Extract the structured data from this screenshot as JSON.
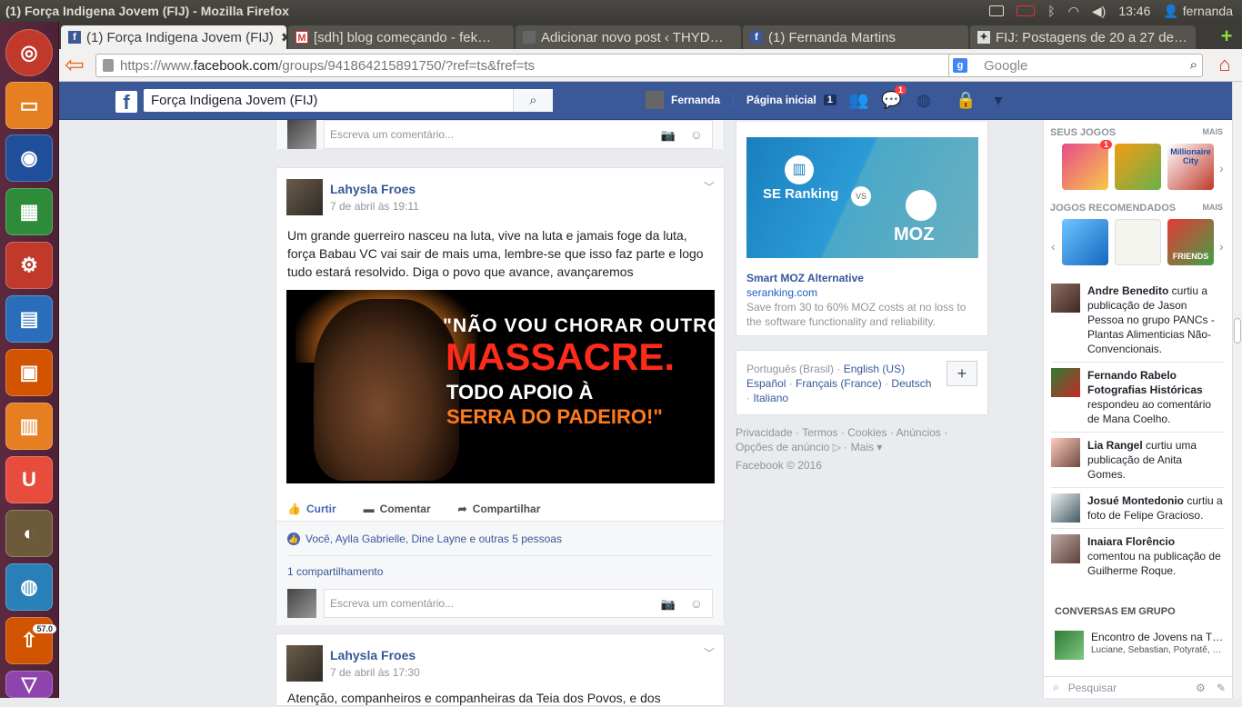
{
  "os": {
    "window_title": "(1) Força Indigena Jovem (FIJ) - Mozilla Firefox",
    "clock": "13:46",
    "user": "fernanda",
    "launcher_badge": "57.0"
  },
  "browser": {
    "tabs": [
      {
        "label": "(1) Força Indigena Jovem (FIJ)",
        "active": true
      },
      {
        "label": "[sdh] blog começando - fek…"
      },
      {
        "label": "Adicionar novo post ‹ THYD…"
      },
      {
        "label": "(1) Fernanda Martins"
      },
      {
        "label": "FIJ: Postagens de 20 a 27 de…"
      }
    ],
    "url_prefix": "https://www.",
    "url_domain": "facebook.com",
    "url_path": "/groups/941864215891750/?ref=ts&fref=ts",
    "search_placeholder": "Google"
  },
  "fb_header": {
    "search_value": "Força Indigena Jovem (FIJ)",
    "profile_name": "Fernanda",
    "home_label": "Página inicial",
    "home_count": "1",
    "messages_badge": "1"
  },
  "feed": {
    "comment_placeholder": "Escreva um comentário...",
    "post1": {
      "author": "Lahysla Froes",
      "time": "7 de abril às 19:11",
      "text": "Um grande guerreiro nasceu na luta, vive na luta e jamais foge da luta, força Babau VC vai sair de mais uma, lembre-se que isso faz parte e logo tudo estará resolvido. Diga o povo que avance, avançaremos",
      "image_line1": "\"NÃO VOU CHORAR OUTRO",
      "image_line2": "MASSACRE.",
      "image_line3": "TODO APOIO À",
      "image_line4": "SERRA DO PADEIRO!\"",
      "like_label": "Curtir",
      "comment_label": "Comentar",
      "share_label": "Compartilhar",
      "likes_text": "Você, Aylla Gabrielle, Dine Layne e outras 5 pessoas",
      "shares_text": "1 compartilhamento"
    },
    "post2": {
      "author": "Lahysla Froes",
      "time": "7 de abril às 17:30",
      "text": "Atenção, companheiros e companheiras da Teia dos Povos, e dos"
    }
  },
  "ad": {
    "brand_left": "SE Ranking",
    "vs": "VS",
    "brand_right": "MOZ",
    "title": "Smart MOZ Alternative",
    "url": "seranking.com",
    "text": "Save from 30 to 60% MOZ costs at no loss to the software functionality and reliability."
  },
  "languages": {
    "current": "Português (Brasil)",
    "options": [
      "English (US)",
      "Español",
      "Français (France)",
      "Deutsch",
      "Italiano"
    ]
  },
  "footer": {
    "links": [
      "Privacidade",
      "Termos",
      "Cookies",
      "Anúncios",
      "Opções de anúncio",
      "Mais"
    ],
    "copyright": "Facebook © 2016"
  },
  "ticker": {
    "my_games_label": "SEUS JOGOS",
    "recommended_label": "JOGOS RECOMENDADOS",
    "more_label": "MAIS",
    "my_games_badge": "1",
    "game_city": "Millionaire City",
    "game_friends": "FRIENDS",
    "items": [
      {
        "name": "Andre Benedito",
        "rest": " curtiu a publicação de Jason Pessoa no grupo PANCs - Plantas Alimenticias Não-Convencionais."
      },
      {
        "name": "Fernando Rabelo Fotografias Históricas",
        "rest": " respondeu ao comentário de Mana Coelho."
      },
      {
        "name": "Lia Rangel",
        "rest": " curtiu uma publicação de Anita Gomes."
      },
      {
        "name": "Josué Montedonio",
        "rest": " curtiu a foto de Felipe Gracioso."
      },
      {
        "name": "Inaiara Florêncio",
        "rest": " comentou na publicação de Guilherme Roque."
      }
    ],
    "conversations_label": "CONVERSAS EM GRUPO",
    "conversation_title": "Encontro de Jovens na T…",
    "conversation_members": "Luciane, Sebastian, Potyratê, …",
    "search_placeholder": "Pesquisar"
  }
}
